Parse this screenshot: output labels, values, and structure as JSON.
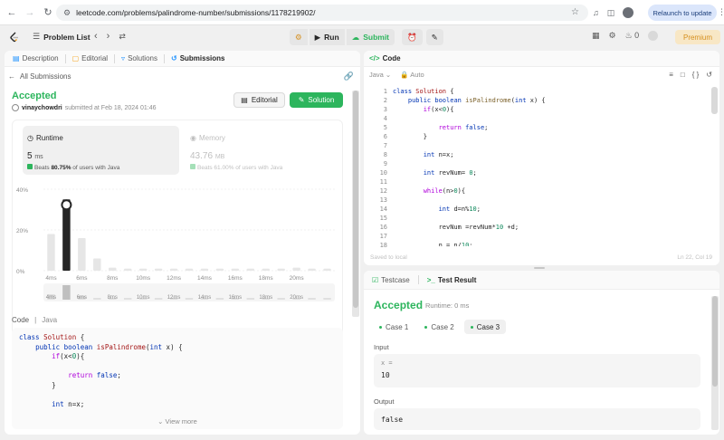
{
  "browser": {
    "url": "leetcode.com/problems/palindrome-number/submissions/1178219902/",
    "relaunch_label": "Relaunch to update"
  },
  "header": {
    "problem_list": "Problem List",
    "run": "Run",
    "submit": "Submit",
    "notifications": "0",
    "premium": "Premium"
  },
  "left_tabs": [
    {
      "label": "Description"
    },
    {
      "label": "Editorial"
    },
    {
      "label": "Solutions"
    },
    {
      "label": "Submissions"
    }
  ],
  "submission": {
    "back_label": "All Submissions",
    "status": "Accepted",
    "username": "vinaychowdri",
    "submitted_text": "submitted at Feb 18, 2024 01:46",
    "editorial_button": "Editorial",
    "solution_button": "Solution"
  },
  "runtime": {
    "label": "Runtime",
    "value": "5",
    "unit": "ms",
    "beats_prefix": "Beats",
    "beats_value": "80.75%",
    "beats_suffix": "of users with Java"
  },
  "memory": {
    "label": "Memory",
    "value": "43.76",
    "unit": "MB",
    "beats_text": "Beats 61.00% of users with Java"
  },
  "chart_data": {
    "type": "bar",
    "y_ticks": [
      "40%",
      "20%",
      "0%"
    ],
    "ylim": [
      0,
      40
    ],
    "x_tick_labels": [
      "4ms",
      "6ms",
      "8ms",
      "10ms",
      "12ms",
      "14ms",
      "16ms",
      "18ms",
      "20ms"
    ],
    "values": [
      18,
      35,
      16,
      6,
      1.5,
      1,
      1,
      1,
      1,
      1,
      1,
      1,
      1,
      1,
      1,
      1,
      1.5,
      1,
      1
    ],
    "highlight_index": 1,
    "overview_values": [
      3,
      8,
      2,
      1,
      1,
      1,
      1,
      1,
      1,
      1,
      1,
      1,
      1,
      1,
      1,
      1,
      1,
      1,
      1
    ]
  },
  "code_section": {
    "label": "Code",
    "language": "Java",
    "view_more": "View more"
  },
  "editor": {
    "tab_label": "Code",
    "language": "Java",
    "mode": "Auto",
    "saved": "Saved to local",
    "position": "Ln 22, Col 19",
    "line_numbers": [
      "1",
      "2",
      "3",
      "4",
      "5",
      "6",
      "7",
      "8",
      "9",
      "10",
      "11",
      "12",
      "13",
      "14",
      "15",
      "16",
      "17",
      "18"
    ]
  },
  "test_panel": {
    "testcase_tab": "Testcase",
    "result_tab": "Test Result",
    "status": "Accepted",
    "runtime": "Runtime: 0 ms",
    "cases": [
      {
        "label": "Case 1"
      },
      {
        "label": "Case 2"
      },
      {
        "label": "Case 3"
      }
    ],
    "input_label": "Input",
    "input_var": "x =",
    "input_value": "10",
    "output_label": "Output",
    "output_value": "false"
  },
  "colors": {
    "accent_green": "#2db55d",
    "orange": "#d58f1e",
    "bar_dark": "#262626",
    "bar_light": "#e6e6e6"
  }
}
